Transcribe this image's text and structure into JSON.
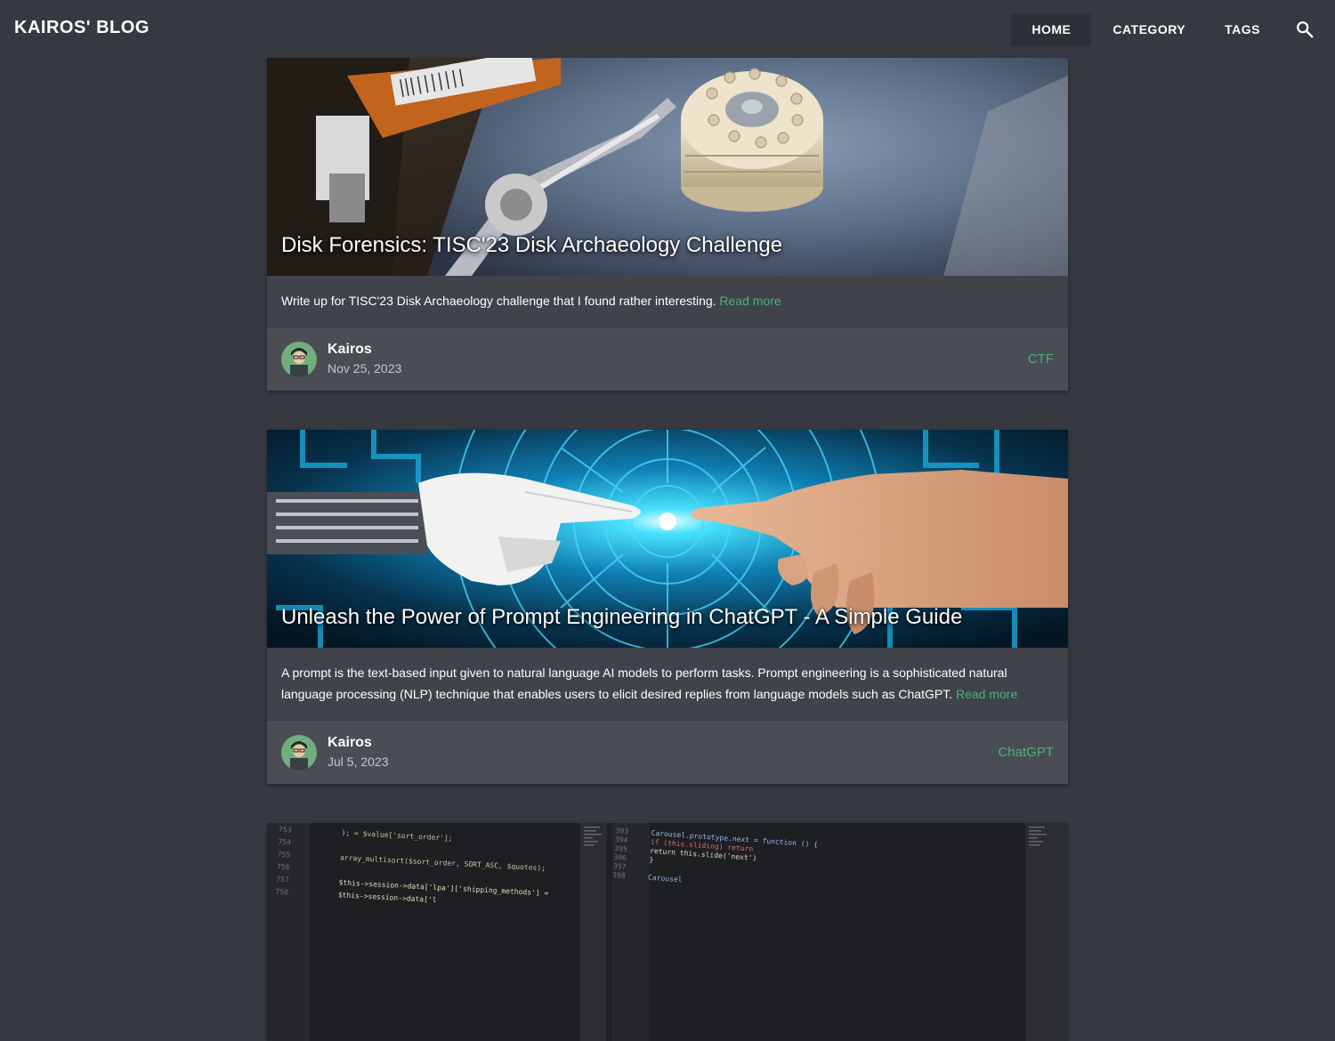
{
  "site": {
    "title": "KAIROS' BLOG"
  },
  "nav": {
    "items": [
      {
        "label": "HOME"
      },
      {
        "label": "CATEGORY"
      },
      {
        "label": "TAGS"
      }
    ],
    "search_icon": "search-icon"
  },
  "colors": {
    "background": "#363940",
    "card": "#40434a",
    "footer": "#4a4d54",
    "accent_green": "#4caf7d"
  },
  "posts": [
    {
      "title": "Disk Forensics: TISC'23 Disk Archaeology Challenge",
      "summary": "Write up for TISC'23 Disk Archaeology challenge that I found rather interesting.",
      "read_more": "Read more",
      "author": "Kairos",
      "date": "Nov 25, 2023",
      "tag": "CTF",
      "image": "hard-drive-image"
    },
    {
      "title": "Unleash the Power of Prompt Engineering in ChatGPT - A Simple Guide",
      "summary": "A prompt is the text-based input given to natural language AI models to perform tasks. Prompt engineering is a sophisticated natural language processing (NLP) technique that enables users to elicit desired replies from language models such as ChatGPT.",
      "read_more": "Read more",
      "author": "Kairos",
      "date": "Jul 5, 2023",
      "tag": "ChatGPT",
      "image": "robot-human-hands-image"
    },
    {
      "image": "code-editor-image",
      "code_lines": [
        {
          "num": "753",
          "text": "); = $value['sort_order'];"
        },
        {
          "num": "754",
          "text": ""
        },
        {
          "num": "755",
          "text": "array_multisort($sort_order, SORT_ASC, $quotes);"
        },
        {
          "num": "756",
          "text": ""
        },
        {
          "num": "757",
          "text": "$this->session->data['lpa']['shipping_methods'] ="
        },
        {
          "num": "758",
          "text": "$this->session->data['l"
        }
      ],
      "code_lines_right": [
        {
          "num": "393",
          "text": "Carousel.prototype.next = function () {"
        },
        {
          "num": "394",
          "text": "  if (this.sliding) return"
        },
        {
          "num": "395",
          "text": "  return this.slide('next')"
        },
        {
          "num": "396",
          "text": "}"
        },
        {
          "num": "397",
          "text": ""
        },
        {
          "num": "398",
          "text": "Carousel"
        }
      ]
    }
  ]
}
